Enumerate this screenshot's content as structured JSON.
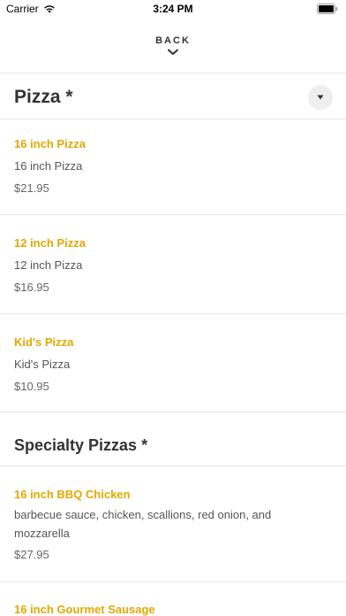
{
  "status": {
    "carrier": "Carrier",
    "time": "3:24 PM"
  },
  "nav": {
    "back_label": "BACK"
  },
  "sections": [
    {
      "title": "Pizza *",
      "items": [
        {
          "name": "16 inch Pizza",
          "description": "16 inch Pizza",
          "price": "$21.95"
        },
        {
          "name": "12 inch Pizza",
          "description": "12 inch Pizza",
          "price": "$16.95"
        },
        {
          "name": "Kid's Pizza",
          "description": "Kid's Pizza",
          "price": "$10.95"
        }
      ]
    },
    {
      "title": "Specialty Pizzas *",
      "items": [
        {
          "name": "16 inch BBQ Chicken",
          "description": "barbecue sauce, chicken, scallions, red onion, and mozzarella",
          "price": "$27.95"
        },
        {
          "name": "16 inch Gourmet Sausage"
        }
      ]
    }
  ],
  "colors": {
    "accent": "#e0a800",
    "text": "#333333",
    "divider": "#e8e8e8"
  },
  "icons": {
    "wifi": "wifi-icon",
    "battery": "battery-icon",
    "back": "chevron-down-icon",
    "dropdown": "triangle-down-icon"
  }
}
